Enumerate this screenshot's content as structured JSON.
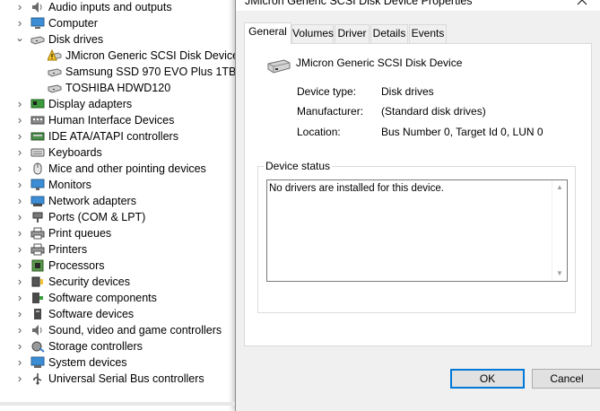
{
  "device_tree": {
    "items": [
      {
        "label": "Audio inputs and outputs",
        "icon": "speaker-icon",
        "expander": "collapsed",
        "depth": 0
      },
      {
        "label": "Computer",
        "icon": "computer-icon",
        "expander": "collapsed",
        "depth": 0
      },
      {
        "label": "Disk drives",
        "icon": "disk-drive-icon",
        "expander": "expanded",
        "depth": 0
      },
      {
        "label": "JMicron Generic SCSI Disk Device",
        "icon": "warning-disk-icon",
        "expander": "none",
        "depth": 1
      },
      {
        "label": "Samsung SSD 970 EVO Plus 1TB",
        "icon": "disk-drive-icon",
        "expander": "none",
        "depth": 1
      },
      {
        "label": "TOSHIBA HDWD120",
        "icon": "disk-drive-icon",
        "expander": "none",
        "depth": 1
      },
      {
        "label": "Display adapters",
        "icon": "display-adapter-icon",
        "expander": "collapsed",
        "depth": 0
      },
      {
        "label": "Human Interface Devices",
        "icon": "hid-icon",
        "expander": "collapsed",
        "depth": 0
      },
      {
        "label": "IDE ATA/ATAPI controllers",
        "icon": "ide-controller-icon",
        "expander": "collapsed",
        "depth": 0
      },
      {
        "label": "Keyboards",
        "icon": "keyboard-icon",
        "expander": "collapsed",
        "depth": 0
      },
      {
        "label": "Mice and other pointing devices",
        "icon": "mouse-icon",
        "expander": "collapsed",
        "depth": 0
      },
      {
        "label": "Monitors",
        "icon": "monitor-icon",
        "expander": "collapsed",
        "depth": 0
      },
      {
        "label": "Network adapters",
        "icon": "network-adapter-icon",
        "expander": "collapsed",
        "depth": 0
      },
      {
        "label": "Ports (COM & LPT)",
        "icon": "port-icon",
        "expander": "collapsed",
        "depth": 0
      },
      {
        "label": "Print queues",
        "icon": "printer-icon",
        "expander": "collapsed",
        "depth": 0
      },
      {
        "label": "Printers",
        "icon": "printer-icon",
        "expander": "collapsed",
        "depth": 0
      },
      {
        "label": "Processors",
        "icon": "processor-icon",
        "expander": "collapsed",
        "depth": 0
      },
      {
        "label": "Security devices",
        "icon": "security-device-icon",
        "expander": "collapsed",
        "depth": 0
      },
      {
        "label": "Software components",
        "icon": "software-component-icon",
        "expander": "collapsed",
        "depth": 0
      },
      {
        "label": "Software devices",
        "icon": "software-device-icon",
        "expander": "collapsed",
        "depth": 0
      },
      {
        "label": "Sound, video and game controllers",
        "icon": "speaker-icon",
        "expander": "collapsed",
        "depth": 0
      },
      {
        "label": "Storage controllers",
        "icon": "storage-controller-icon",
        "expander": "collapsed",
        "depth": 0
      },
      {
        "label": "System devices",
        "icon": "system-device-icon",
        "expander": "collapsed",
        "depth": 0
      },
      {
        "label": "Universal Serial Bus controllers",
        "icon": "usb-icon",
        "expander": "collapsed",
        "depth": 0
      }
    ]
  },
  "dialog": {
    "title": "JMicron Generic SCSI Disk Device Properties",
    "tabs": [
      {
        "label": "General",
        "active": true
      },
      {
        "label": "Volumes",
        "active": false
      },
      {
        "label": "Driver",
        "active": false
      },
      {
        "label": "Details",
        "active": false
      },
      {
        "label": "Events",
        "active": false
      }
    ],
    "device_name": "JMicron Generic SCSI Disk Device",
    "properties": {
      "device_type_label": "Device type:",
      "device_type_value": "Disk drives",
      "manufacturer_label": "Manufacturer:",
      "manufacturer_value": "(Standard disk drives)",
      "location_label": "Location:",
      "location_value": "Bus Number 0, Target Id 0, LUN 0"
    },
    "device_status": {
      "legend": "Device status",
      "text": "No drivers are installed for this device."
    },
    "buttons": {
      "ok": "OK",
      "cancel": "Cancel"
    }
  },
  "colors": {
    "accent": "#0078d7",
    "warning": "#f4c430",
    "dialog_bg": "#f0f0f0"
  }
}
